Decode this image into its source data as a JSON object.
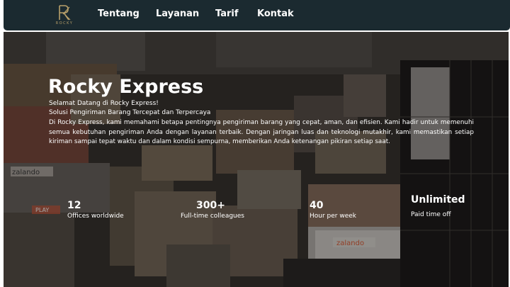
{
  "brand": {
    "logo_text": "ROCKY"
  },
  "nav": {
    "items": [
      {
        "label": "Tentang"
      },
      {
        "label": "Layanan"
      },
      {
        "label": "Tarif"
      },
      {
        "label": "Kontak"
      }
    ]
  },
  "hero": {
    "title": "Rocky Express",
    "welcome": "Selamat Datang di  Rocky Express!",
    "tagline": "Solusi Pengiriman Barang Tercepat dan Terpercaya",
    "description": "Di Rocky Express, kami memahami betapa pentingnya pengiriman barang yang cepat, aman, dan efisien. Kami hadir untuk memenuhi semua kebutuhan pengiriman Anda dengan layanan terbaik. Dengan jaringan luas dan teknologi mutakhir, kami memastikan setiap kiriman sampai tepat waktu dan dalam kondisi sempurna, memberikan Anda ketenangan pikiran setiap saat.",
    "background_labels": {
      "label_a": "zalando",
      "label_b": "PLAY"
    }
  },
  "stats": [
    {
      "value": "12",
      "label": "Offices worldwide"
    },
    {
      "value": "300+",
      "label": "Full-time colleagues"
    },
    {
      "value": "40",
      "label": "Hour per week"
    },
    {
      "value": "Unlimited",
      "label": "Paid time off"
    }
  ],
  "colors": {
    "navbar_bg": "#1b2a30",
    "text": "#ffffff",
    "logo_gold": "#b8a06a"
  }
}
